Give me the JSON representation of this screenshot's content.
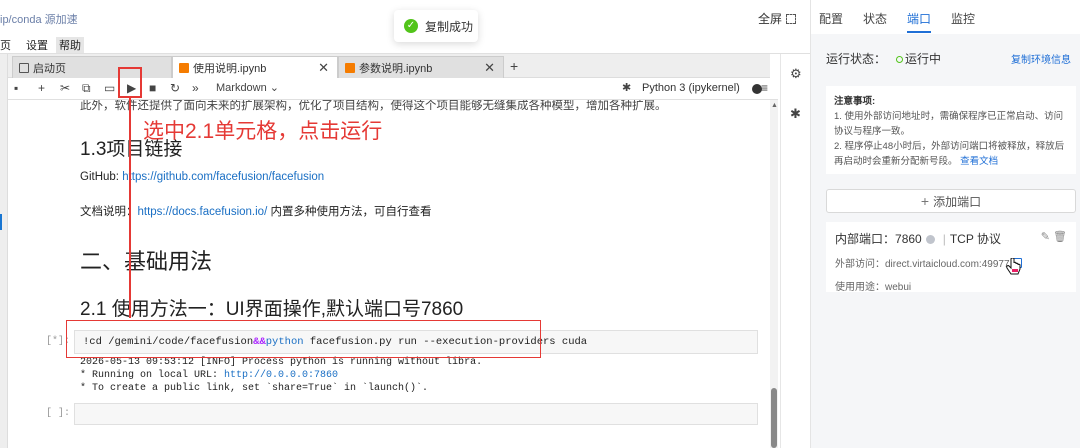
{
  "topbar": {
    "link_text": "ip/conda 源加速",
    "fullscreen_label": "全屏"
  },
  "toast": {
    "text": "复制成功",
    "icon": "check-circle-icon",
    "color": "#52c41a"
  },
  "menubar": {
    "items": [
      "页",
      "设置",
      "帮助"
    ]
  },
  "tabs": [
    {
      "label": "启动页",
      "icon": "launcher-icon",
      "active": false
    },
    {
      "label": "使用说明.ipynb",
      "icon": "notebook-icon",
      "active": true
    },
    {
      "label": "参数说明.ipynb",
      "icon": "notebook-icon",
      "active": false
    }
  ],
  "toolbar": {
    "cell_type": "Markdown",
    "kernel": "Python 3 (ipykernel)"
  },
  "notebook": {
    "cut_line": "此外，软件还提供了面向未来的扩展架构，优化了项目结构，使得这个项目能够无缝集成各种模型，增加各种扩展。",
    "h_links": "1.3项目链接",
    "github_label": "GitHub: ",
    "github_url": "https://github.com/facefusion/facefusion",
    "docs_label": "文档说明：",
    "docs_url": "https://docs.facefusion.io/",
    "docs_suffix": " 内置多种使用方法，可自行查看",
    "h_usage": "二、基础用法",
    "h_method": "2.1 使用方法一：UI界面操作,默认端口号7860",
    "cell_prompt": "[*]:",
    "code_a": "!cd /gemini/code/facefusion",
    "code_op": "&&",
    "code_kw": "python",
    "code_b": " facefusion.py run --execution-providers cuda",
    "out1": "2026-05-13 09:53:12 [INFO] Process python is running without libra.",
    "out2_a": "* Running on local URL:  ",
    "out2_url": "http://0.0.0.0:7860",
    "out3": "* To create a public link, set `share=True` in `launch()`.",
    "empty_prompt": "[ ]:"
  },
  "annotation": {
    "text": "选中2.1单元格，点击运行",
    "color": "#e53935"
  },
  "right_panel": {
    "tabs": [
      "配置",
      "状态",
      "端口",
      "监控"
    ],
    "active_tab": "端口",
    "status_label": "运行状态：",
    "status_value": "运行中",
    "copy_env": "复制环境信息",
    "notice_title": "注意事项:",
    "notice_1": "1. 使用外部访问地址时，需确保程序已正常启动、访问协议与程序一致。",
    "notice_2": "2. 程序停止48小时后，外部访问端口将被释放，释放后再启动时会重新分配新号段。",
    "notice_link": "查看文档",
    "add_port": "添加端口",
    "port_internal_label": "内部端口：",
    "port_internal": "7860",
    "port_protocol": "TCP 协议",
    "external_label": "外部访问：",
    "external_value": "direct.virtaicloud.com:49977",
    "usage_label": "使用用途：",
    "usage_value": "webui"
  }
}
